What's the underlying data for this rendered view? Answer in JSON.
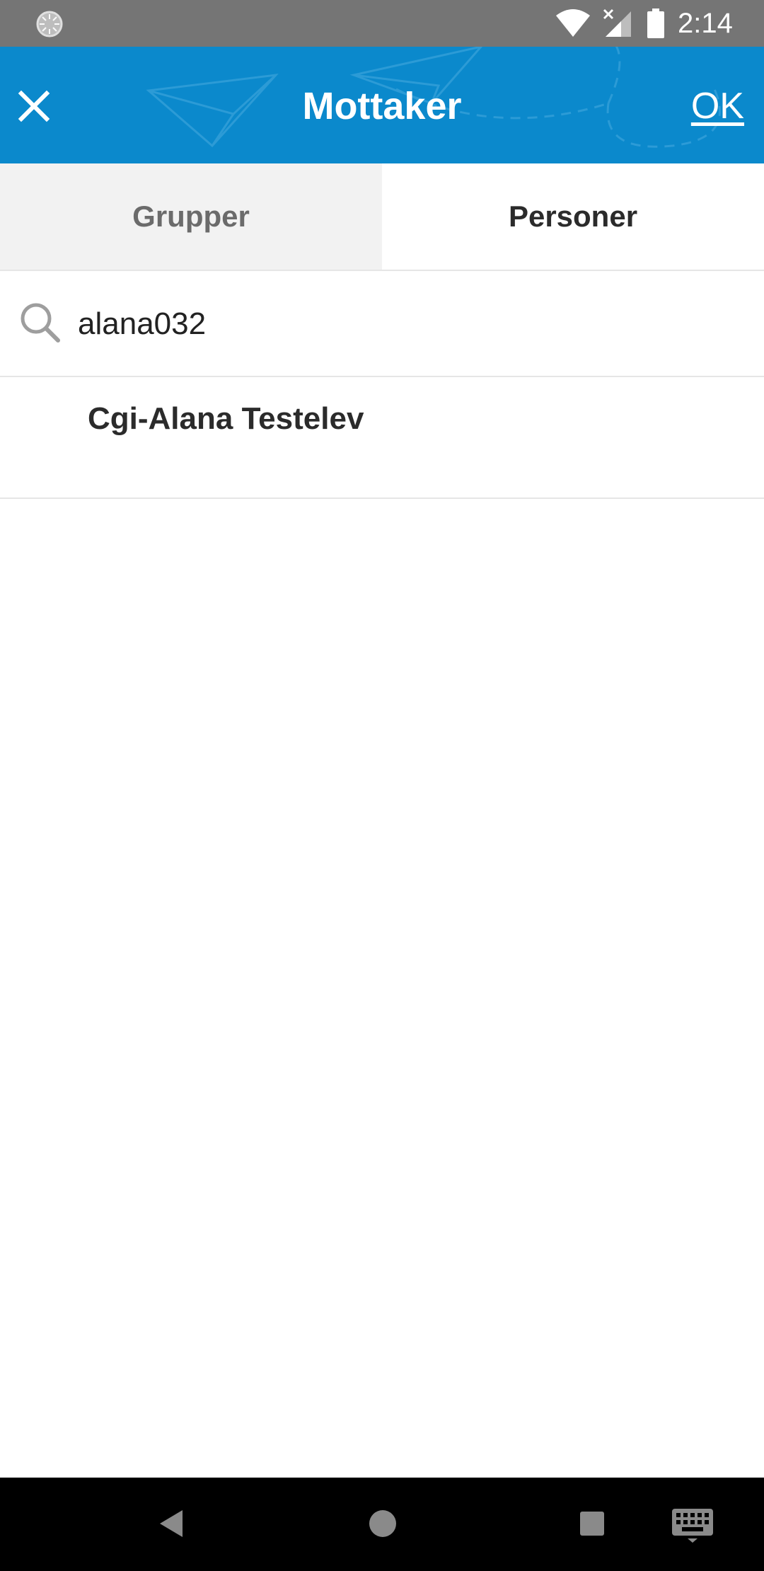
{
  "status_bar": {
    "time": "2:14",
    "icons": [
      "loading-icon",
      "wifi-icon",
      "signal-no-data-icon",
      "battery-icon"
    ]
  },
  "app_bar": {
    "title": "Mottaker",
    "ok_label": "OK",
    "close_icon": "close-icon",
    "color": "#0b89cc"
  },
  "tabs": [
    {
      "label": "Grupper",
      "active": false
    },
    {
      "label": "Personer",
      "active": true
    }
  ],
  "search": {
    "value": "alana032",
    "icon": "search-icon"
  },
  "results": [
    {
      "name": "Cgi-Alana Testelev"
    }
  ],
  "nav_bar": {
    "icons": [
      "back-icon",
      "home-icon",
      "recents-icon",
      "keyboard-icon"
    ]
  }
}
